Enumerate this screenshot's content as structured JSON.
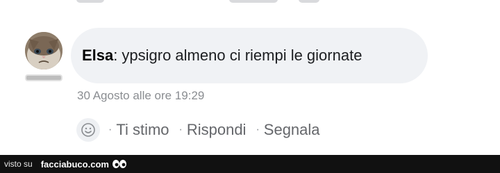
{
  "comment": {
    "author": "Elsa",
    "separator": ":",
    "message": "ypsigro almeno ci riempi le giornate",
    "timestamp": "30 Agosto alle ore 19:29"
  },
  "actions": {
    "separator": "·",
    "like": "Ti stimo",
    "reply": "Rispondi",
    "report": "Segnala"
  },
  "footer": {
    "seen_on": "visto su",
    "site": "facciabuco.com"
  },
  "icons": {
    "avatar": "grumpy-cat-avatar",
    "emoji": "smiley-icon",
    "logo": "eyes-icon"
  },
  "colors": {
    "bubble": "#f0f2f5",
    "meta_text": "#8a8d91",
    "action_text": "#65676b",
    "footer_bg": "#111111"
  }
}
